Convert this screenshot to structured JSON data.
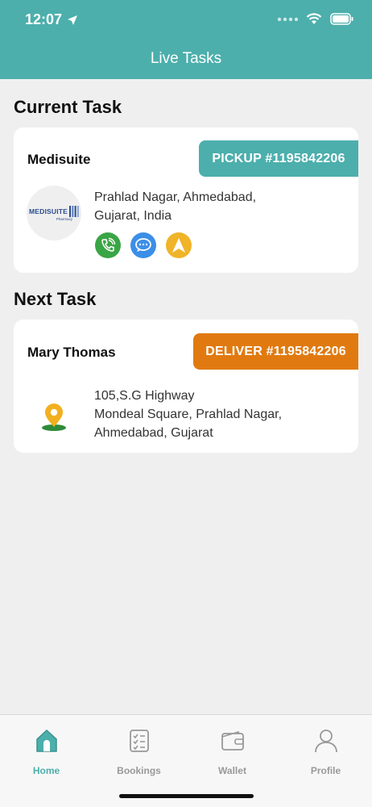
{
  "status_bar": {
    "time": "12:07"
  },
  "header": {
    "title": "Live Tasks"
  },
  "current_task": {
    "section_title": "Current Task",
    "name": "Medisuite",
    "tag": "PICKUP #1195842206",
    "address_line1": "Prahlad Nagar, Ahmedabad,",
    "address_line2": "Gujarat, India",
    "logo_text": "MEDISUITE",
    "logo_subtext": "Pharmacy",
    "tag_color": "#4cafac"
  },
  "next_task": {
    "section_title": "Next Task",
    "name": "Mary Thomas",
    "tag": "DELIVER #1195842206",
    "address_line1": "105,S.G Highway",
    "address_line2": "Mondeal Square, Prahlad Nagar,",
    "address_line3": "Ahmedabad, Gujarat",
    "tag_color": "#e07a10"
  },
  "tabs": [
    {
      "label": "Home",
      "icon": "home-icon",
      "active": true
    },
    {
      "label": "Bookings",
      "icon": "bookings-icon",
      "active": false
    },
    {
      "label": "Wallet",
      "icon": "wallet-icon",
      "active": false
    },
    {
      "label": "Profile",
      "icon": "profile-icon",
      "active": false
    }
  ],
  "colors": {
    "accent": "#4cafac",
    "deliver": "#e07a10",
    "call": "#3aa544",
    "chat": "#3b8fe8",
    "navigate": "#f0b429"
  }
}
